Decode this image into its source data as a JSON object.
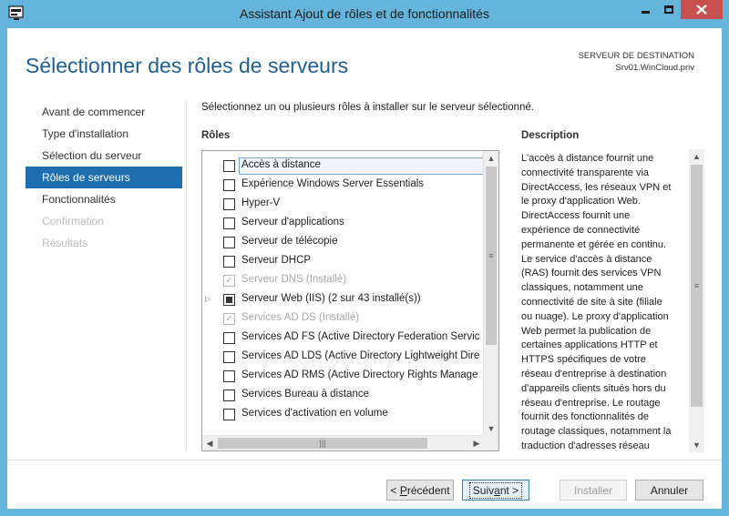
{
  "window": {
    "title": "Assistant Ajout de rôles et de fonctionnalités"
  },
  "header": {
    "page_title": "Sélectionner des rôles de serveurs",
    "destination_label": "SERVEUR DE DESTINATION",
    "destination_server": "Srv01.WinCloud.priv"
  },
  "nav": {
    "items": [
      {
        "label": "Avant de commencer",
        "state": "normal"
      },
      {
        "label": "Type d'installation",
        "state": "normal"
      },
      {
        "label": "Sélection du serveur",
        "state": "normal"
      },
      {
        "label": "Rôles de serveurs",
        "state": "active"
      },
      {
        "label": "Fonctionnalités",
        "state": "normal"
      },
      {
        "label": "Confirmation",
        "state": "disabled"
      },
      {
        "label": "Résultats",
        "state": "disabled"
      }
    ]
  },
  "main": {
    "instruction": "Sélectionnez un ou plusieurs rôles à installer sur le serveur sélectionné.",
    "roles_heading": "Rôles",
    "description_heading": "Description",
    "roles": [
      {
        "label": "Accès à distance",
        "checked": false,
        "selected": true
      },
      {
        "label": "Expérience Windows Server Essentials",
        "checked": false
      },
      {
        "label": "Hyper-V",
        "checked": false
      },
      {
        "label": "Serveur d'applications",
        "checked": false
      },
      {
        "label": "Serveur de télécopie",
        "checked": false
      },
      {
        "label": "Serveur DHCP",
        "checked": false
      },
      {
        "label": "Serveur DNS (Installé)",
        "checked": true,
        "disabled": true
      },
      {
        "label": "Serveur Web (IIS) (2 sur 43 installé(s))",
        "partial": true,
        "expandable": true
      },
      {
        "label": "Services AD DS (Installé)",
        "checked": true,
        "disabled": true
      },
      {
        "label": "Services AD FS (Active Directory Federation Servic",
        "checked": false
      },
      {
        "label": "Services AD LDS (Active Directory Lightweight Dire",
        "checked": false
      },
      {
        "label": "Services AD RMS (Active Directory Rights Manage",
        "checked": false
      },
      {
        "label": "Services Bureau à distance",
        "checked": false
      },
      {
        "label": "Services d'activation en volume",
        "checked": false
      }
    ],
    "description_lines": [
      "L'accès à distance fournit une",
      "connectivité transparente via",
      "DirectAccess, les réseaux VPN et",
      "le proxy d'application Web.",
      "DirectAccess fournit une",
      "expérience de connectivité",
      "permanente et gérée en continu.",
      "Le service d'accès à distance",
      "(RAS) fournit des services VPN",
      "classiques, notamment une",
      "connectivité de site à site (filiale",
      "ou nuage). Le proxy d'application",
      "Web permet la publication de",
      "certaines applications HTTP et",
      "HTTPS spécifiques de votre",
      "réseau d'entreprise à destination",
      "d'appareils clients situés hors du",
      "réseau d'entreprise. Le routage",
      "fournit des fonctionnalités de",
      "routage classiques, notamment la",
      "traduction d'adresses réseau"
    ]
  },
  "footer": {
    "prev_prefix": "< ",
    "prev_mnemonic": "P",
    "prev_rest": "récédent",
    "next_prefix": "Suiv",
    "next_mnemonic": "a",
    "next_rest": "nt >",
    "install_label": "Installer",
    "cancel_label": "Annuler"
  }
}
